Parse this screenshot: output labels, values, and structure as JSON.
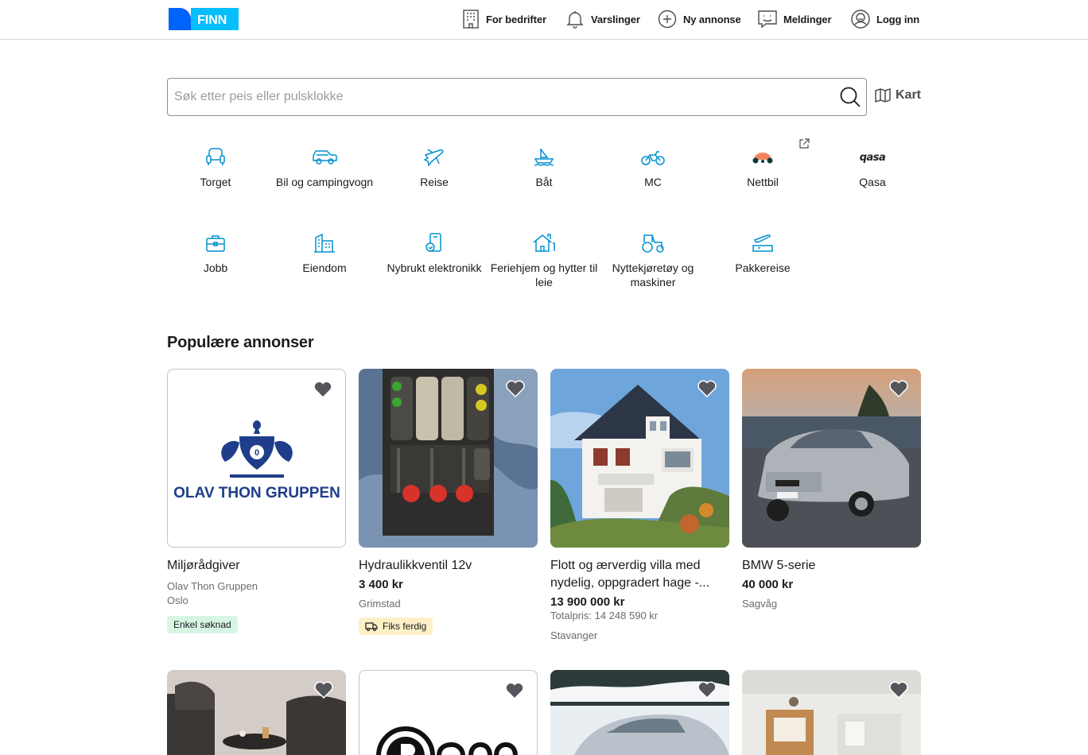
{
  "header": {
    "logo_text": "FINN",
    "nav": {
      "business": "For bedrifter",
      "alerts": "Varslinger",
      "new_ad": "Ny annonse",
      "messages": "Meldinger",
      "login": "Logg inn"
    }
  },
  "search": {
    "placeholder": "Søk etter peis eller pulsklokke",
    "value": "",
    "map_label": "Kart"
  },
  "categories": [
    {
      "label": "Torget",
      "icon": "armchair-icon"
    },
    {
      "label": "Bil og campingvogn",
      "icon": "car-icon"
    },
    {
      "label": "Reise",
      "icon": "airplane-icon"
    },
    {
      "label": "Båt",
      "icon": "boat-icon"
    },
    {
      "label": "MC",
      "icon": "motorcycle-icon"
    },
    {
      "label": "Nettbil",
      "icon": "nettbil-logo"
    },
    {
      "label": "Qasa",
      "icon": "qasa-logo",
      "logo_text": "qasa"
    },
    {
      "label": "Jobb",
      "icon": "briefcase-icon"
    },
    {
      "label": "Eiendom",
      "icon": "buildings-icon"
    },
    {
      "label": "Nybrukt elektronikk",
      "icon": "phone-check-icon"
    },
    {
      "label": "Feriehjem og hytter til leie",
      "icon": "holiday-home-icon"
    },
    {
      "label": "Nyttekjøretøy og maskiner",
      "icon": "tractor-icon"
    },
    {
      "label": "Pakkereise",
      "icon": "package-travel-icon"
    }
  ],
  "popular": {
    "title": "Populære annonser",
    "items": [
      {
        "title": "Miljørådgiver",
        "company": "Olav Thon Gruppen",
        "location": "Oslo",
        "badge": "Enkel søknad",
        "logo_text": "OLAV THON GRUPPEN"
      },
      {
        "title": "Hydraulikkventil 12v",
        "price": "3 400 kr",
        "location": "Grimstad",
        "badge": "Fiks ferdig"
      },
      {
        "title": "Flott og ærverdig villa med nydelig, oppgradert hage -...",
        "price": "13 900 000 kr",
        "total": "Totalpris: 14 248 590 kr",
        "location": "Stavanger"
      },
      {
        "title": "BMW 5-serie",
        "price": "40 000 kr",
        "location": "Sagvåg"
      }
    ]
  },
  "colors": {
    "finn_blue": "#0063fb",
    "finn_light_blue": "#06befb",
    "icon_blue": "#0090d0",
    "badge_green": "#d6f5e3",
    "badge_yellow": "#fdf0c6"
  }
}
